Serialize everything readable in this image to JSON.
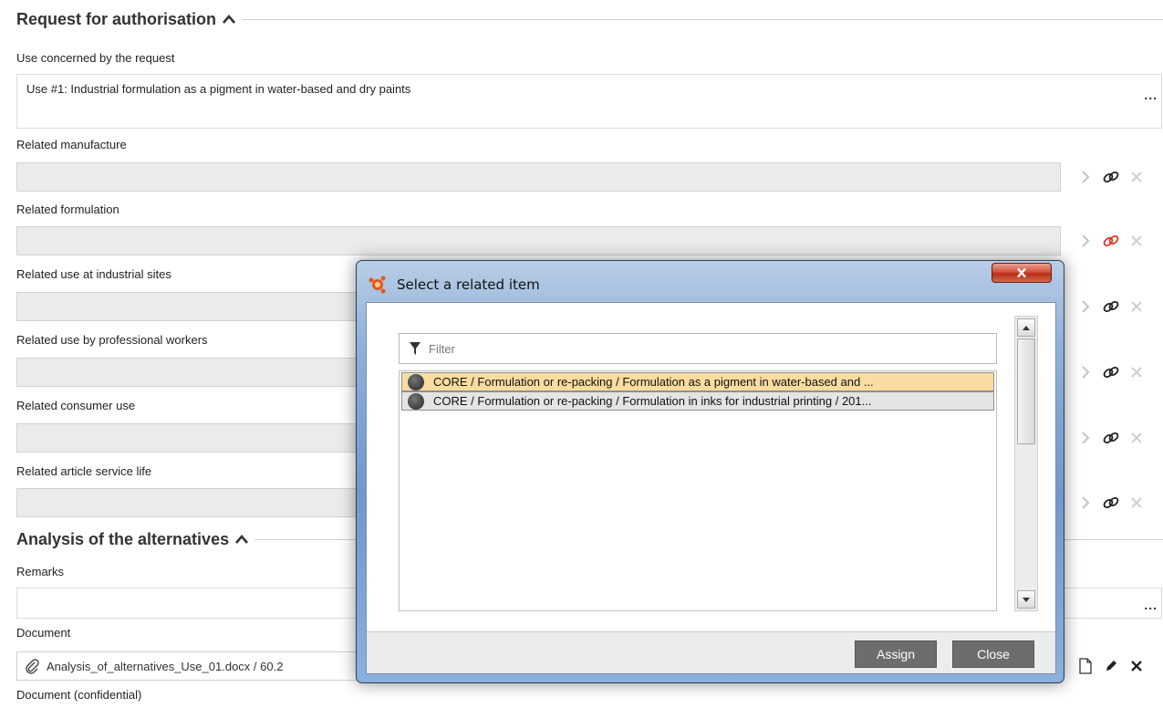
{
  "sections": {
    "request": {
      "title": "Request for authorisation"
    },
    "analysis": {
      "title": "Analysis of the alternatives"
    }
  },
  "fields": {
    "use_concerned": {
      "label": "Use concerned by the request",
      "value": "Use #1: Industrial formulation as a pigment in water-based and dry paints",
      "more": "..."
    },
    "related_manufacture": {
      "label": "Related manufacture"
    },
    "related_formulation": {
      "label": "Related formulation"
    },
    "related_industrial": {
      "label": "Related use at industrial sites"
    },
    "related_professional": {
      "label": "Related use by professional workers"
    },
    "related_consumer": {
      "label": "Related consumer use"
    },
    "related_article": {
      "label": "Related article service life"
    },
    "remarks": {
      "label": "Remarks",
      "more": "..."
    },
    "document": {
      "label": "Document",
      "value": "Analysis_of_alternatives_Use_01.docx / 60.2"
    },
    "document_confidential": {
      "label": "Document (confidential)"
    }
  },
  "dialog": {
    "title": "Select a related item",
    "filter_placeholder": "Filter",
    "items": [
      {
        "label": "CORE / Formulation or re-packing / Formulation as a pigment in water-based and ...",
        "selected": true
      },
      {
        "label": "CORE / Formulation or re-packing / Formulation in inks for industrial printing / 201...",
        "selected": false
      }
    ],
    "assign_label": "Assign",
    "close_label": "Close"
  },
  "colors": {
    "accent_link_active": "#d43a2a",
    "selected_row": "#fbdca0",
    "button_bg": "#6d6d6d"
  },
  "icons": {
    "section_caret": "chevron-up-icon",
    "navigate": "chevron-right-icon",
    "link": "link-icon",
    "remove": "close-icon",
    "attachment": "paperclip-icon",
    "new_document": "document-icon",
    "edit": "pencil-icon",
    "filter": "filter-icon"
  }
}
